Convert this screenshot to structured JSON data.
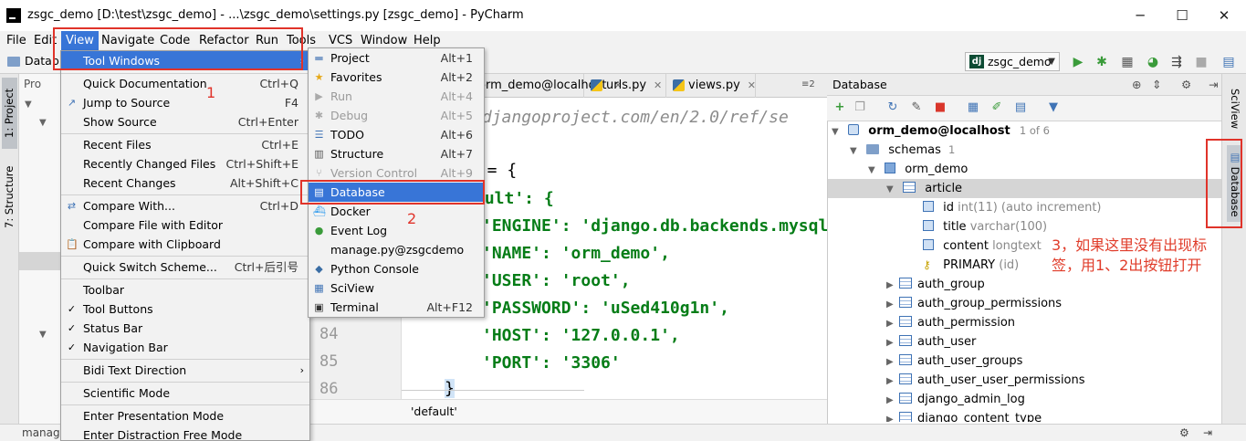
{
  "window": {
    "title": "zsgc_demo [D:\\test\\zsgc_demo] - ...\\zsgc_demo\\settings.py [zsgc_demo] - PyCharm"
  },
  "menubar": [
    "File",
    "Edit",
    "View",
    "Navigate",
    "Code",
    "Refactor",
    "Run",
    "Tools",
    "VCS",
    "Window",
    "Help"
  ],
  "navbar": {
    "breadcrumb": "Datab",
    "run_config": "zsgc_demo"
  },
  "left_stripe": [
    "1: Project",
    "7: Structure"
  ],
  "project_panel": {
    "tab": "Pro"
  },
  "view_menu": [
    {
      "label": "Tool Windows",
      "shortcut": "",
      "submenu": true,
      "selected": true
    },
    {
      "label": "Quick Documentation",
      "shortcut": "Ctrl+Q"
    },
    {
      "label": "Jump to Source",
      "shortcut": "F4"
    },
    {
      "label": "Show Source",
      "shortcut": "Ctrl+Enter"
    },
    {
      "label": "Recent Files",
      "shortcut": "Ctrl+E"
    },
    {
      "label": "Recently Changed Files",
      "shortcut": "Ctrl+Shift+E"
    },
    {
      "label": "Recent Changes",
      "shortcut": "Alt+Shift+C"
    },
    {
      "label": "Compare With...",
      "shortcut": "Ctrl+D"
    },
    {
      "label": "Compare File with Editor",
      "shortcut": ""
    },
    {
      "label": "Compare with Clipboard",
      "shortcut": ""
    },
    {
      "label": "Quick Switch Scheme...",
      "shortcut": "Ctrl+后引号"
    },
    {
      "label": "Toolbar",
      "shortcut": ""
    },
    {
      "label": "Tool Buttons",
      "shortcut": "",
      "checked": true
    },
    {
      "label": "Status Bar",
      "shortcut": "",
      "checked": true
    },
    {
      "label": "Navigation Bar",
      "shortcut": "",
      "checked": true
    },
    {
      "label": "Bidi Text Direction",
      "shortcut": "",
      "submenu": true
    },
    {
      "label": "Scientific Mode",
      "shortcut": ""
    },
    {
      "label": "Enter Presentation Mode",
      "shortcut": ""
    },
    {
      "label": "Enter Distraction Free Mode",
      "shortcut": ""
    }
  ],
  "tool_windows_menu": [
    {
      "label": "Project",
      "shortcut": "Alt+1"
    },
    {
      "label": "Favorites",
      "shortcut": "Alt+2"
    },
    {
      "label": "Run",
      "shortcut": "Alt+4",
      "disabled": true
    },
    {
      "label": "Debug",
      "shortcut": "Alt+5",
      "disabled": true
    },
    {
      "label": "TODO",
      "shortcut": "Alt+6"
    },
    {
      "label": "Structure",
      "shortcut": "Alt+7"
    },
    {
      "label": "Version Control",
      "shortcut": "Alt+9",
      "disabled": true
    },
    {
      "label": "Database",
      "shortcut": "",
      "selected": true
    },
    {
      "label": "Docker",
      "shortcut": ""
    },
    {
      "label": "Event Log",
      "shortcut": ""
    },
    {
      "label": "manage.py@zsgcdemo",
      "shortcut": ""
    },
    {
      "label": "Python Console",
      "shortcut": ""
    },
    {
      "label": "SciView",
      "shortcut": ""
    },
    {
      "label": "Terminal",
      "shortcut": "Alt+F12"
    }
  ],
  "annotations": {
    "one": "1",
    "two": "2",
    "three": "3，如果这里没有出现标签，用1、2出按钮打开"
  },
  "editor": {
    "tabs": [
      {
        "label": "orm_demo@localhost"
      },
      {
        "label": "urls.py"
      },
      {
        "label": "views.py"
      }
    ],
    "tab_overflow": "≡2",
    "line_numbers": [
      "84",
      "85",
      "86"
    ],
    "code_lines": [
      "//docs.djangoproject.com/en/2.0/ref/se",
      "S = {",
      "ault': {",
      "'ENGINE': 'django.db.backends.mysql",
      "'NAME': 'orm_demo',",
      "'USER': 'root',",
      "'PASSWORD': 'uSed410g1n',",
      "'HOST': '127.0.0.1',",
      "'PORT': '3306'",
      "}"
    ],
    "breadcrumb": "'default'"
  },
  "database": {
    "title": "Database",
    "connection": "orm_demo@localhost",
    "connection_count": "1 of 6",
    "schemas_label": "schemas",
    "schemas_count": "1",
    "schema": "orm_demo",
    "table": "article",
    "columns": [
      {
        "name": "id",
        "type": "int(11) (auto increment)"
      },
      {
        "name": "title",
        "type": "varchar(100)"
      },
      {
        "name": "content",
        "type": "longtext"
      }
    ],
    "key": {
      "name": "PRIMARY",
      "type": "(id)"
    },
    "other_tables": [
      "auth_group",
      "auth_group_permissions",
      "auth_permission",
      "auth_user",
      "auth_user_groups",
      "auth_user_user_permissions",
      "django_admin_log",
      "django_content_type"
    ]
  },
  "right_stripe": [
    "SciView",
    "Database"
  ],
  "statusbar": {
    "text": "manage"
  },
  "colors": {
    "selection": "#3875d7",
    "annotation": "#e0332a"
  }
}
